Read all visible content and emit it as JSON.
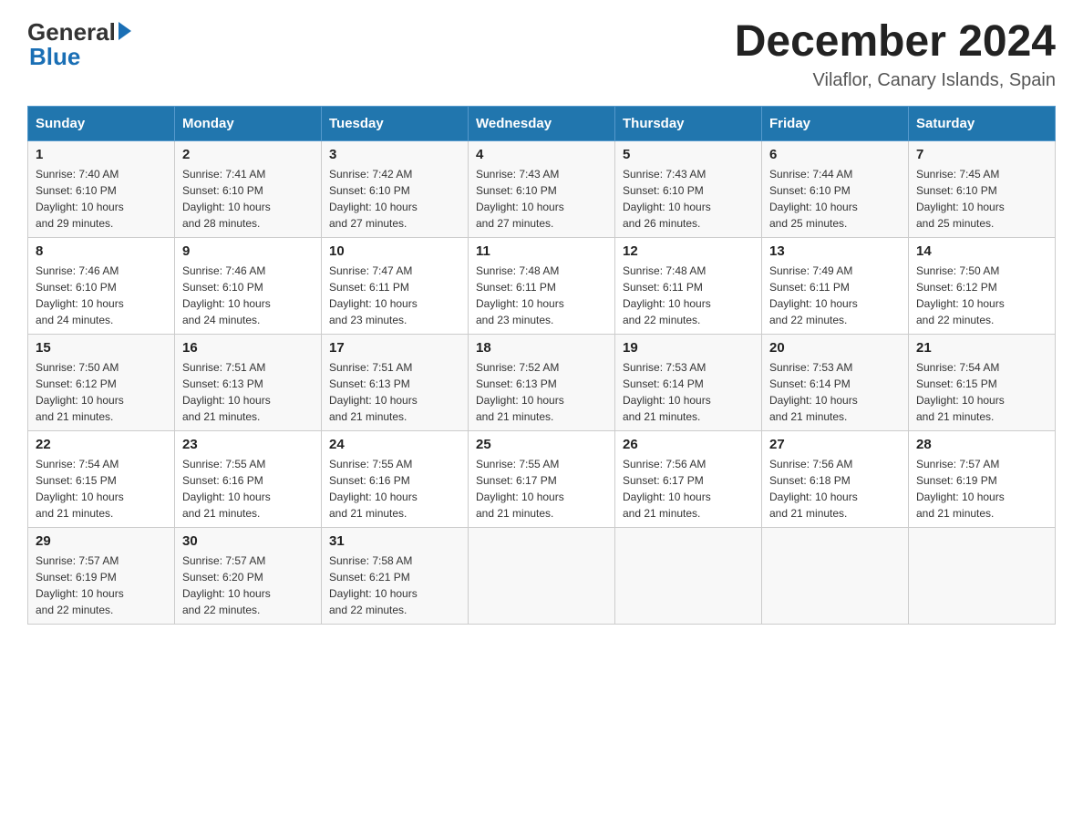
{
  "header": {
    "logo_general": "General",
    "logo_blue": "Blue",
    "title": "December 2024",
    "subtitle": "Vilaflor, Canary Islands, Spain"
  },
  "columns": [
    "Sunday",
    "Monday",
    "Tuesday",
    "Wednesday",
    "Thursday",
    "Friday",
    "Saturday"
  ],
  "weeks": [
    [
      {
        "day": "1",
        "sunrise": "7:40 AM",
        "sunset": "6:10 PM",
        "daylight": "10 hours and 29 minutes."
      },
      {
        "day": "2",
        "sunrise": "7:41 AM",
        "sunset": "6:10 PM",
        "daylight": "10 hours and 28 minutes."
      },
      {
        "day": "3",
        "sunrise": "7:42 AM",
        "sunset": "6:10 PM",
        "daylight": "10 hours and 27 minutes."
      },
      {
        "day": "4",
        "sunrise": "7:43 AM",
        "sunset": "6:10 PM",
        "daylight": "10 hours and 27 minutes."
      },
      {
        "day": "5",
        "sunrise": "7:43 AM",
        "sunset": "6:10 PM",
        "daylight": "10 hours and 26 minutes."
      },
      {
        "day": "6",
        "sunrise": "7:44 AM",
        "sunset": "6:10 PM",
        "daylight": "10 hours and 25 minutes."
      },
      {
        "day": "7",
        "sunrise": "7:45 AM",
        "sunset": "6:10 PM",
        "daylight": "10 hours and 25 minutes."
      }
    ],
    [
      {
        "day": "8",
        "sunrise": "7:46 AM",
        "sunset": "6:10 PM",
        "daylight": "10 hours and 24 minutes."
      },
      {
        "day": "9",
        "sunrise": "7:46 AM",
        "sunset": "6:10 PM",
        "daylight": "10 hours and 24 minutes."
      },
      {
        "day": "10",
        "sunrise": "7:47 AM",
        "sunset": "6:11 PM",
        "daylight": "10 hours and 23 minutes."
      },
      {
        "day": "11",
        "sunrise": "7:48 AM",
        "sunset": "6:11 PM",
        "daylight": "10 hours and 23 minutes."
      },
      {
        "day": "12",
        "sunrise": "7:48 AM",
        "sunset": "6:11 PM",
        "daylight": "10 hours and 22 minutes."
      },
      {
        "day": "13",
        "sunrise": "7:49 AM",
        "sunset": "6:11 PM",
        "daylight": "10 hours and 22 minutes."
      },
      {
        "day": "14",
        "sunrise": "7:50 AM",
        "sunset": "6:12 PM",
        "daylight": "10 hours and 22 minutes."
      }
    ],
    [
      {
        "day": "15",
        "sunrise": "7:50 AM",
        "sunset": "6:12 PM",
        "daylight": "10 hours and 21 minutes."
      },
      {
        "day": "16",
        "sunrise": "7:51 AM",
        "sunset": "6:13 PM",
        "daylight": "10 hours and 21 minutes."
      },
      {
        "day": "17",
        "sunrise": "7:51 AM",
        "sunset": "6:13 PM",
        "daylight": "10 hours and 21 minutes."
      },
      {
        "day": "18",
        "sunrise": "7:52 AM",
        "sunset": "6:13 PM",
        "daylight": "10 hours and 21 minutes."
      },
      {
        "day": "19",
        "sunrise": "7:53 AM",
        "sunset": "6:14 PM",
        "daylight": "10 hours and 21 minutes."
      },
      {
        "day": "20",
        "sunrise": "7:53 AM",
        "sunset": "6:14 PM",
        "daylight": "10 hours and 21 minutes."
      },
      {
        "day": "21",
        "sunrise": "7:54 AM",
        "sunset": "6:15 PM",
        "daylight": "10 hours and 21 minutes."
      }
    ],
    [
      {
        "day": "22",
        "sunrise": "7:54 AM",
        "sunset": "6:15 PM",
        "daylight": "10 hours and 21 minutes."
      },
      {
        "day": "23",
        "sunrise": "7:55 AM",
        "sunset": "6:16 PM",
        "daylight": "10 hours and 21 minutes."
      },
      {
        "day": "24",
        "sunrise": "7:55 AM",
        "sunset": "6:16 PM",
        "daylight": "10 hours and 21 minutes."
      },
      {
        "day": "25",
        "sunrise": "7:55 AM",
        "sunset": "6:17 PM",
        "daylight": "10 hours and 21 minutes."
      },
      {
        "day": "26",
        "sunrise": "7:56 AM",
        "sunset": "6:17 PM",
        "daylight": "10 hours and 21 minutes."
      },
      {
        "day": "27",
        "sunrise": "7:56 AM",
        "sunset": "6:18 PM",
        "daylight": "10 hours and 21 minutes."
      },
      {
        "day": "28",
        "sunrise": "7:57 AM",
        "sunset": "6:19 PM",
        "daylight": "10 hours and 21 minutes."
      }
    ],
    [
      {
        "day": "29",
        "sunrise": "7:57 AM",
        "sunset": "6:19 PM",
        "daylight": "10 hours and 22 minutes."
      },
      {
        "day": "30",
        "sunrise": "7:57 AM",
        "sunset": "6:20 PM",
        "daylight": "10 hours and 22 minutes."
      },
      {
        "day": "31",
        "sunrise": "7:58 AM",
        "sunset": "6:21 PM",
        "daylight": "10 hours and 22 minutes."
      },
      null,
      null,
      null,
      null
    ]
  ],
  "labels": {
    "sunrise": "Sunrise:",
    "sunset": "Sunset:",
    "daylight": "Daylight:"
  }
}
